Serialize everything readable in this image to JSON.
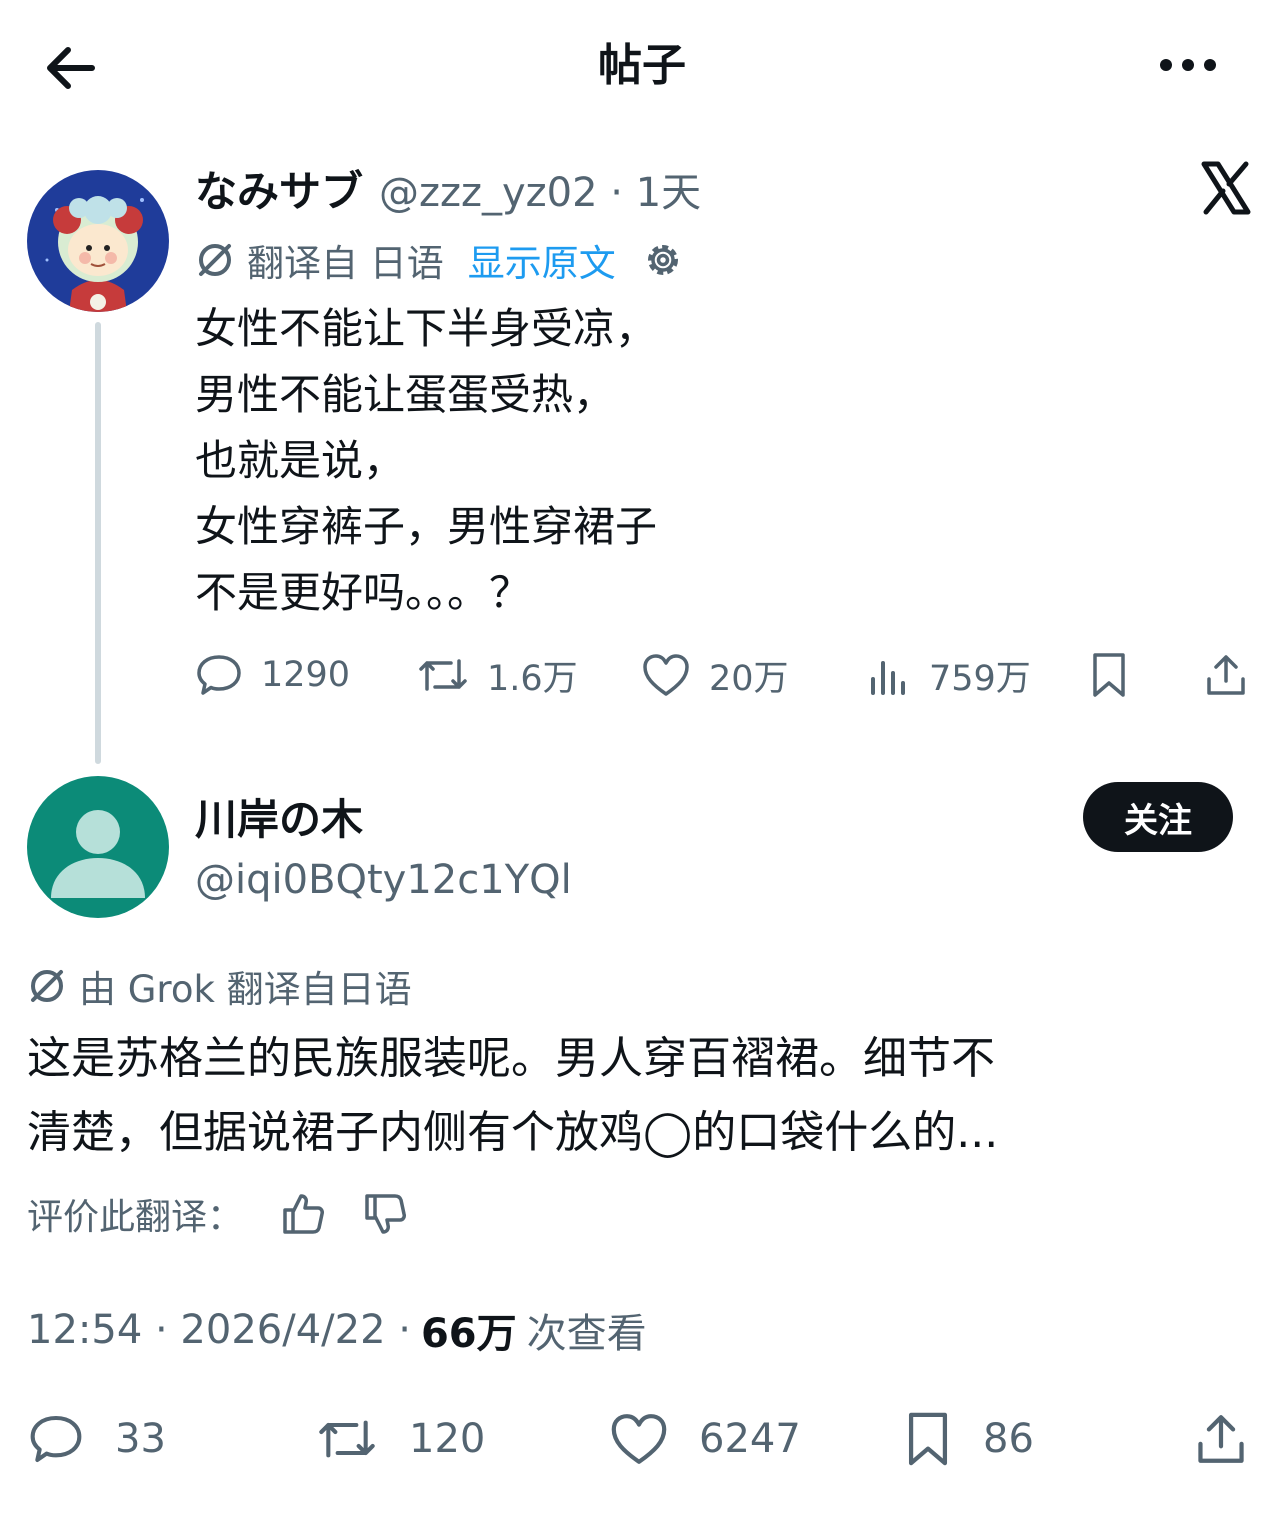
{
  "header": {
    "title": "帖子"
  },
  "original_post": {
    "author_name": "なみサブ",
    "meta": "@zzz_yz02 · 1天",
    "translation_note": "翻译自 日语",
    "show_original": "显示原文",
    "body_lines": [
      "女性不能让下半身受凉，",
      "男性不能让蛋蛋受热，",
      "也就是说，",
      "女性穿裤子，男性穿裙子",
      "不是更好吗。。。？"
    ],
    "stats": {
      "replies": "1290",
      "reposts": "1.6万",
      "likes": "20万",
      "views": "759万"
    }
  },
  "reply_post": {
    "author_name": "川岸の木",
    "handle": "@iqi0BQty12c1YQl",
    "follow_label": "关注",
    "translation_note": "由 Grok 翻译自日语",
    "body_lines": [
      "这是苏格兰的民族服装呢。男人穿百褶裙。细节不",
      "清楚，但据说裙子内侧有个放鸡◯的口袋什么的..."
    ],
    "rate_label": "评价此翻译：",
    "timestamp": "12:54 · 2026/4/22 ·",
    "view_count": "66万",
    "view_label": "次查看",
    "stats": {
      "replies": "33",
      "reposts": "120",
      "likes": "6247",
      "bookmarks": "86"
    }
  },
  "colors": {
    "text": "#0f1419",
    "secondary": "#536471",
    "link": "#1d9bf0",
    "avatar_bg": "#0c8b78"
  }
}
